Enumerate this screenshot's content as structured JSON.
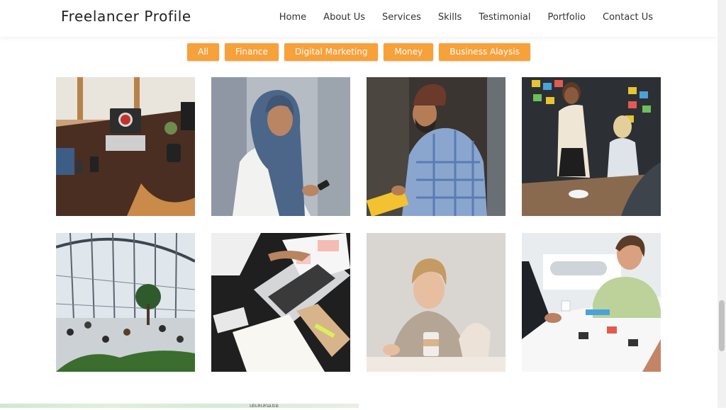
{
  "header": {
    "brand": "Freelancer Profile",
    "nav": [
      "Home",
      "About Us",
      "Services",
      "Skills",
      "Testimonial",
      "Portfolio",
      "Contact Us"
    ]
  },
  "filters": [
    "All",
    "Finance",
    "Digital Marketing",
    "Money",
    "Business Alaysis"
  ],
  "colors": {
    "accent": "#f7a13b",
    "text": "#333333"
  },
  "portfolio": [
    "laptop-desk-photo",
    "woman-hijab-phone-photo",
    "man-turban-writing-photo",
    "presentation-sticky-notes-photo",
    "atrium-people-photo",
    "laptop-planner-photo",
    "woman-coffee-meeting-photo",
    "team-laughing-table-photo"
  ],
  "map": {
    "label": "เดเลเลนเยอ"
  }
}
